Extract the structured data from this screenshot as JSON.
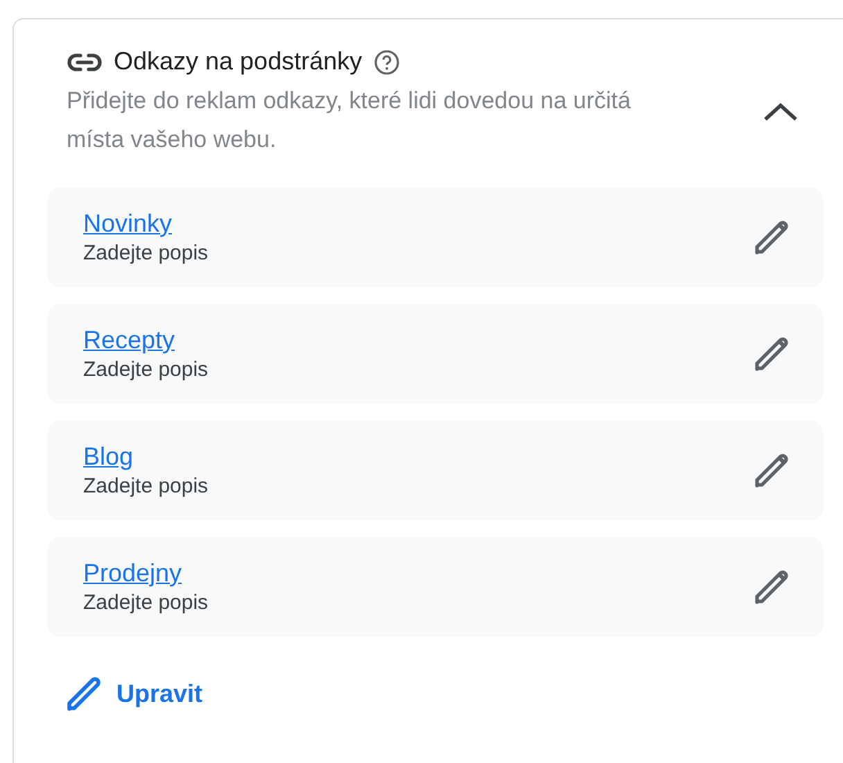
{
  "section": {
    "title": "Odkazy na podstránky",
    "description": "Přidejte do reklam odkazy, které lidi dovedou na určitá místa vašeho webu.",
    "expanded": true
  },
  "links": [
    {
      "label": "Novinky",
      "description": "Zadejte popis"
    },
    {
      "label": "Recepty",
      "description": "Zadejte popis"
    },
    {
      "label": "Blog",
      "description": "Zadejte popis"
    },
    {
      "label": "Prodejny",
      "description": "Zadejte popis"
    }
  ],
  "edit_button": {
    "label": "Upravit"
  }
}
